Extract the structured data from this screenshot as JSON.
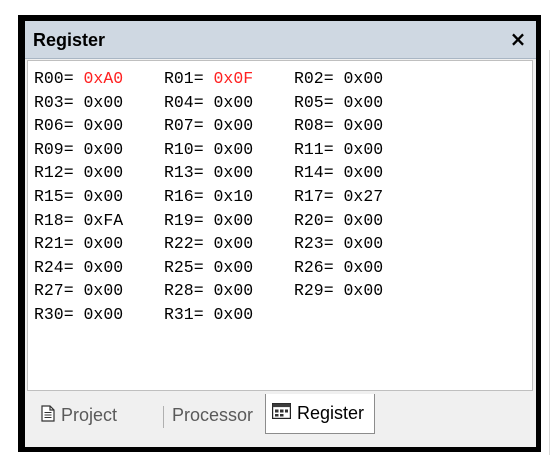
{
  "window": {
    "title": "Register",
    "close_label": "×"
  },
  "registers": [
    [
      {
        "name": "R00=",
        "value": "0xA0",
        "changed": true
      },
      {
        "name": "R01=",
        "value": "0x0F",
        "changed": true
      },
      {
        "name": "R02=",
        "value": "0x00",
        "changed": false
      }
    ],
    [
      {
        "name": "R03=",
        "value": "0x00",
        "changed": false
      },
      {
        "name": "R04=",
        "value": "0x00",
        "changed": false
      },
      {
        "name": "R05=",
        "value": "0x00",
        "changed": false
      }
    ],
    [
      {
        "name": "R06=",
        "value": "0x00",
        "changed": false
      },
      {
        "name": "R07=",
        "value": "0x00",
        "changed": false
      },
      {
        "name": "R08=",
        "value": "0x00",
        "changed": false
      }
    ],
    [
      {
        "name": "R09=",
        "value": "0x00",
        "changed": false
      },
      {
        "name": "R10=",
        "value": "0x00",
        "changed": false
      },
      {
        "name": "R11=",
        "value": "0x00",
        "changed": false
      }
    ],
    [
      {
        "name": "R12=",
        "value": "0x00",
        "changed": false
      },
      {
        "name": "R13=",
        "value": "0x00",
        "changed": false
      },
      {
        "name": "R14=",
        "value": "0x00",
        "changed": false
      }
    ],
    [
      {
        "name": "R15=",
        "value": "0x00",
        "changed": false
      },
      {
        "name": "R16=",
        "value": "0x10",
        "changed": false
      },
      {
        "name": "R17=",
        "value": "0x27",
        "changed": false
      }
    ],
    [
      {
        "name": "R18=",
        "value": "0xFA",
        "changed": false
      },
      {
        "name": "R19=",
        "value": "0x00",
        "changed": false
      },
      {
        "name": "R20=",
        "value": "0x00",
        "changed": false
      }
    ],
    [
      {
        "name": "R21=",
        "value": "0x00",
        "changed": false
      },
      {
        "name": "R22=",
        "value": "0x00",
        "changed": false
      },
      {
        "name": "R23=",
        "value": "0x00",
        "changed": false
      }
    ],
    [
      {
        "name": "R24=",
        "value": "0x00",
        "changed": false
      },
      {
        "name": "R25=",
        "value": "0x00",
        "changed": false
      },
      {
        "name": "R26=",
        "value": "0x00",
        "changed": false
      }
    ],
    [
      {
        "name": "R27=",
        "value": "0x00",
        "changed": false
      },
      {
        "name": "R28=",
        "value": "0x00",
        "changed": false
      },
      {
        "name": "R29=",
        "value": "0x00",
        "changed": false
      }
    ],
    [
      {
        "name": "R30=",
        "value": "0x00",
        "changed": false
      },
      {
        "name": "R31=",
        "value": "0x00",
        "changed": false
      }
    ]
  ],
  "tabs": {
    "project": {
      "label": "Project",
      "icon": "document-icon"
    },
    "processor": {
      "label": "Processor"
    },
    "register": {
      "label": "Register",
      "icon": "register-window-icon",
      "active": true
    }
  },
  "colors": {
    "changed_value": "#ff2020",
    "titlebar": "#cfd8e2"
  }
}
